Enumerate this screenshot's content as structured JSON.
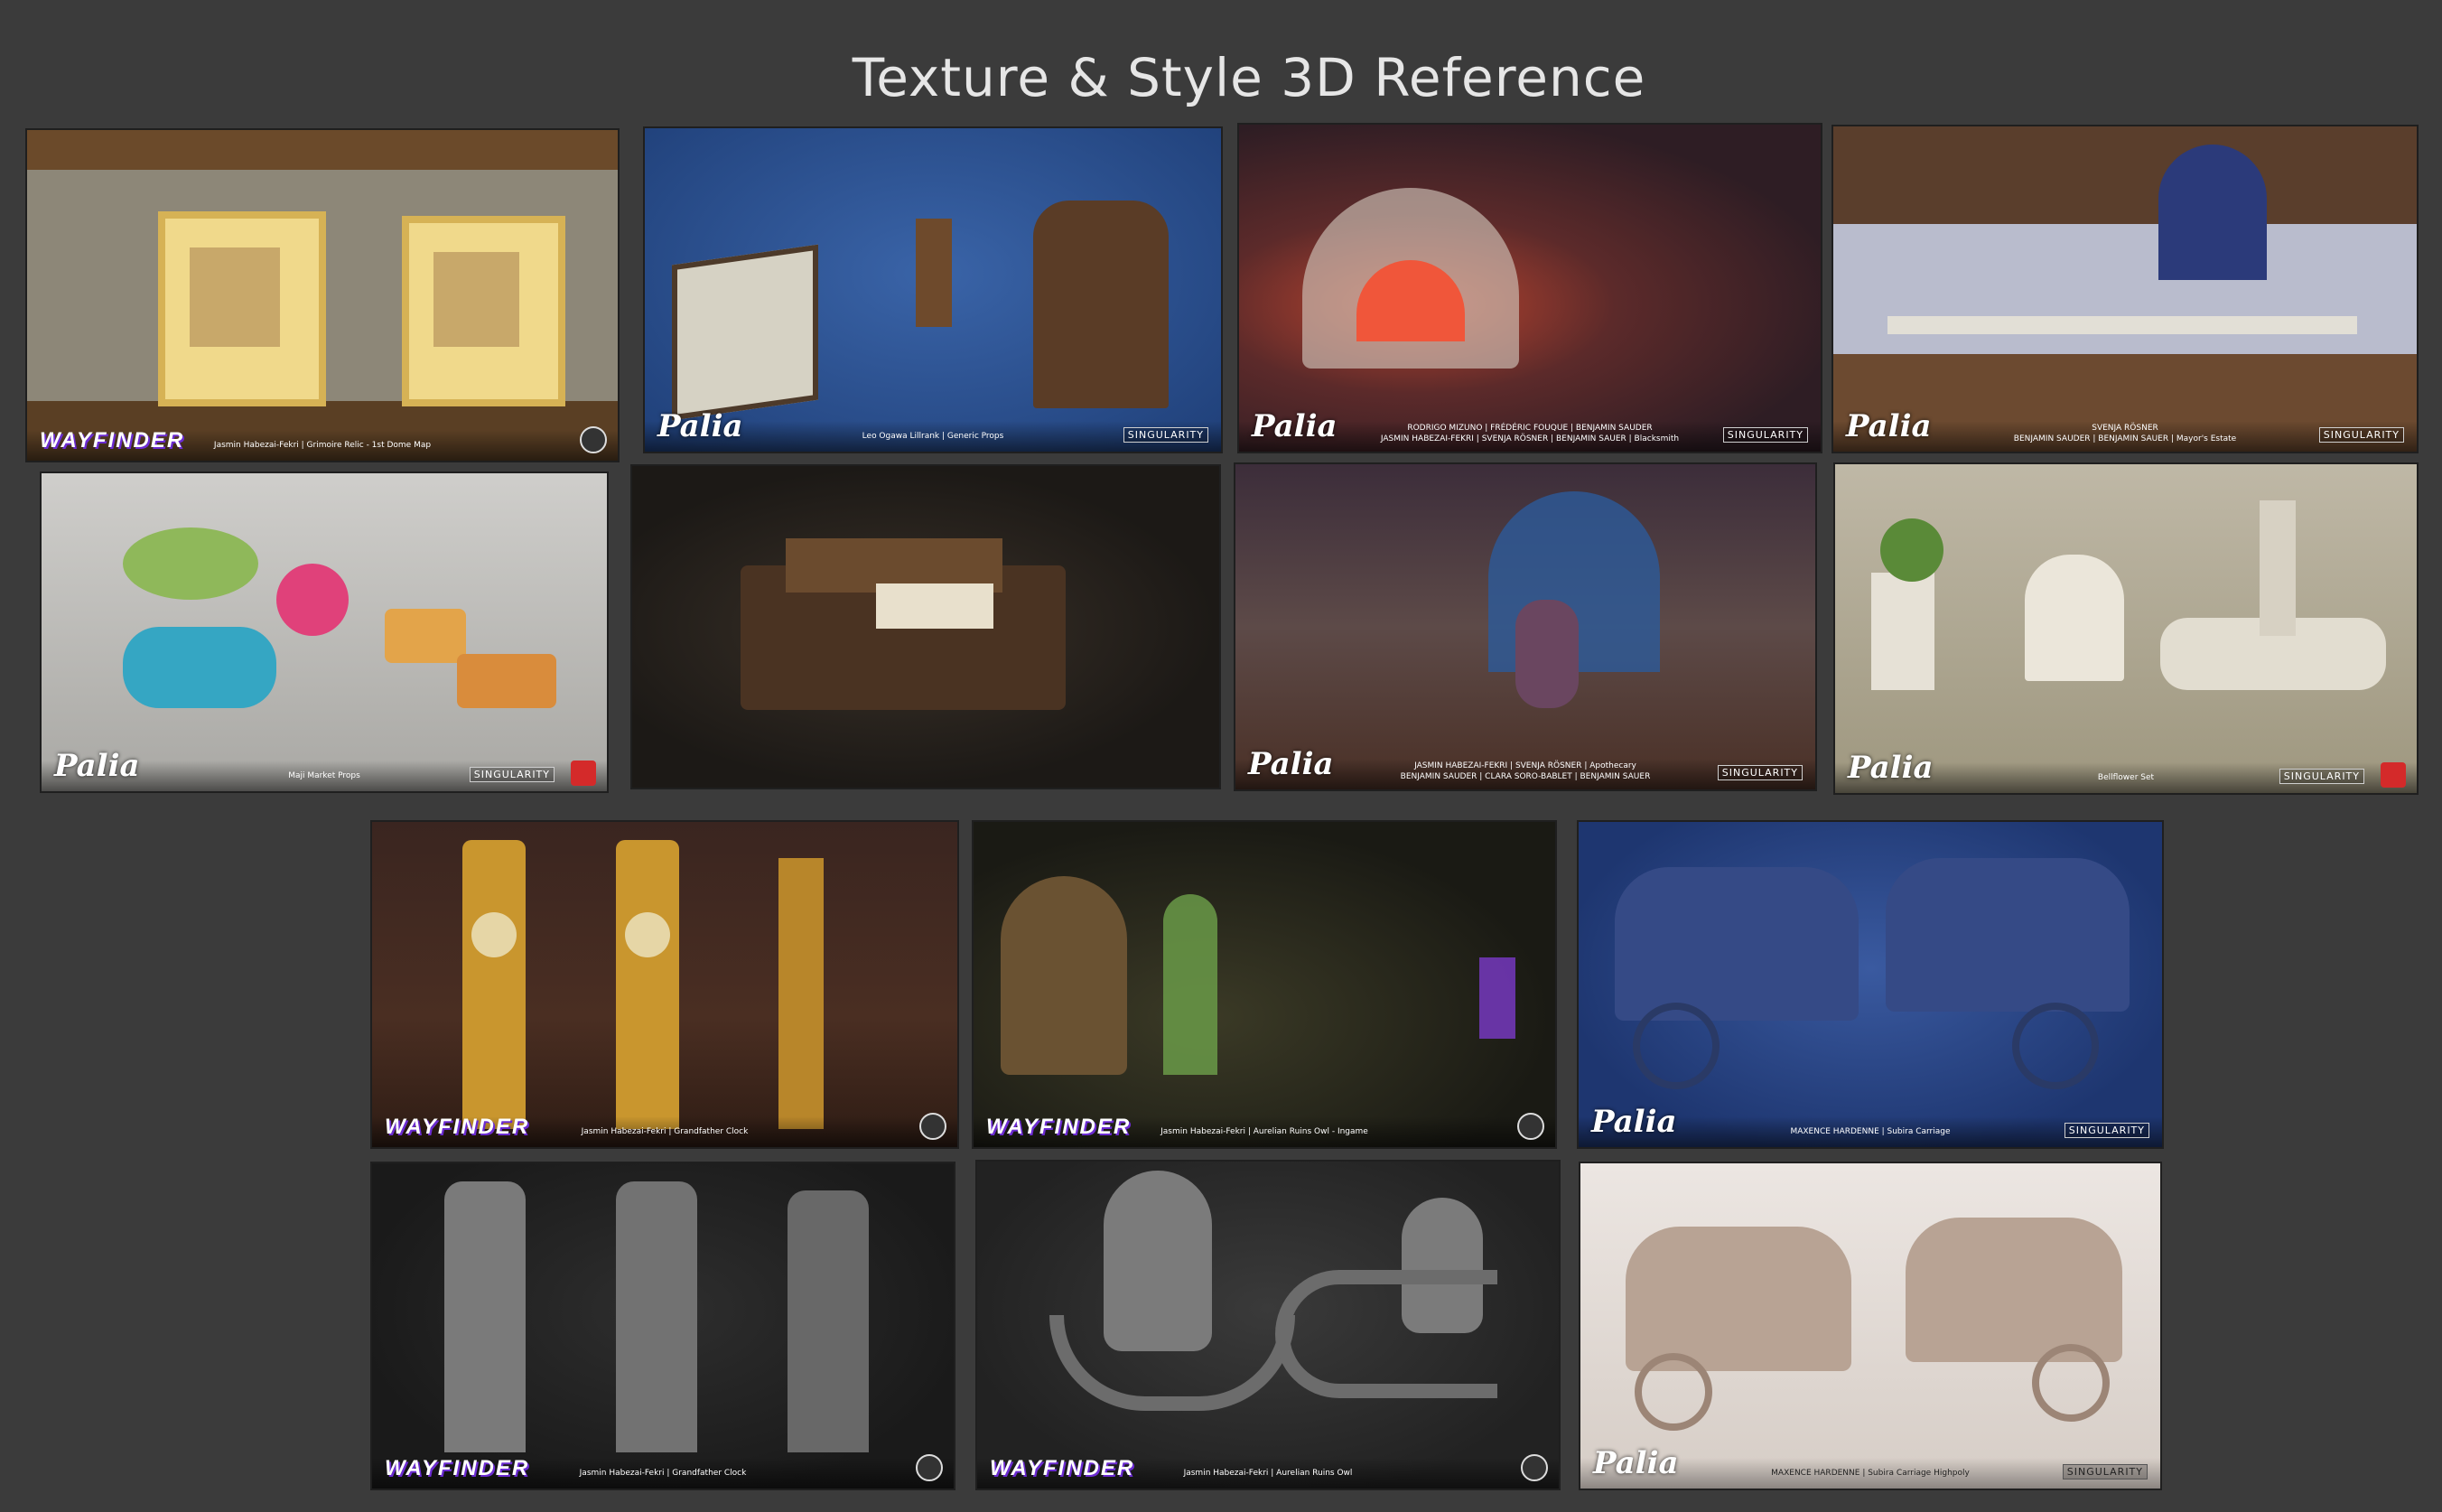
{
  "page": {
    "title": "Texture & Style 3D Reference"
  },
  "tiles": [
    {
      "logo": "WAYFINDER",
      "credit": "Jasmin Habezai-Fekri | Grimoire Relic - 1st Dome Map"
    },
    {
      "logo": "Palia",
      "credit": "Leo Ogawa Lillrank | Generic Props",
      "studio": "SINGULARITY"
    },
    {
      "logo": "Palia",
      "credit_line1": "RODRIGO MIZUNO | FRÉDÉRIC FOUQUE | BENJAMIN SAUDER",
      "credit_line2": "JASMIN HABEZAI-FEKRI | SVENJA RÖSNER | BENJAMIN SAUER | Blacksmith",
      "studio": "SINGULARITY"
    },
    {
      "logo": "Palia",
      "credit_line1": "SVENJA RÖSNER",
      "credit_line2": "BENJAMIN SAUDER | BENJAMIN SAUER | Mayor's Estate",
      "studio": "SINGULARITY"
    },
    {
      "logo": "Palia",
      "credit": "Maji Market Props",
      "studio": "SINGULARITY"
    },
    {
      "logo": "",
      "credit": ""
    },
    {
      "logo": "Palia",
      "credit_line1": "JASMIN HABEZAI-FEKRI | SVENJA RÖSNER | Apothecary",
      "credit_line2": "BENJAMIN SAUDER | CLARA SORO-BABLET | BENJAMIN SAUER",
      "studio": "SINGULARITY"
    },
    {
      "logo": "Palia",
      "credit": "Bellflower Set",
      "studio": "SINGULARITY"
    },
    {
      "logo": "WAYFINDER",
      "credit": "Jasmin Habezai-Fekri | Grandfather Clock"
    },
    {
      "logo": "WAYFINDER",
      "credit": "Jasmin Habezai-Fekri | Aurelian Ruins Owl - Ingame"
    },
    {
      "logo": "Palia",
      "credit": "MAXENCE HARDENNE | Subira Carriage",
      "studio": "SINGULARITY"
    },
    {
      "logo": "WAYFINDER",
      "credit": "Jasmin Habezai-Fekri | Grandfather Clock"
    },
    {
      "logo": "WAYFINDER",
      "credit": "Jasmin Habezai-Fekri | Aurelian Ruins Owl"
    },
    {
      "logo": "Palia",
      "credit": "MAXENCE HARDENNE | Subira Carriage Highpoly",
      "studio": "SINGULARITY"
    }
  ]
}
